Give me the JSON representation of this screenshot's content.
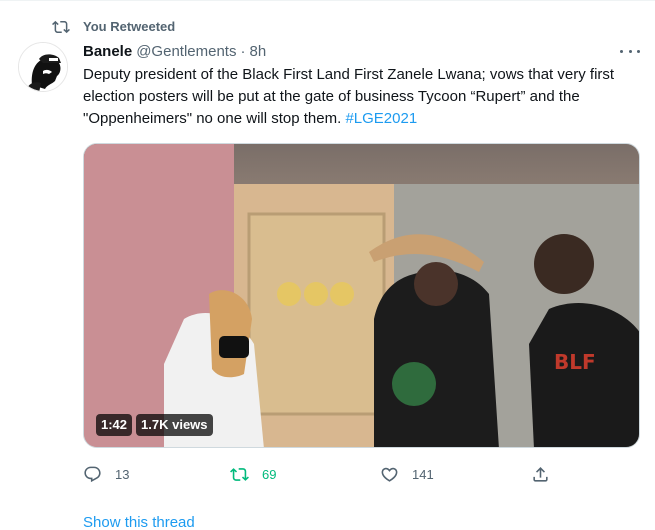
{
  "retweet_context": {
    "text": "You Retweeted",
    "icon": "retweet-icon"
  },
  "tweet": {
    "author_name": "Banele",
    "author_handle": "@Gentlements",
    "separator": "·",
    "time": "8h",
    "text_main": "Deputy president of the Black First Land First Zanele Lwana; vows that very first election posters will be put at the gate of business Tycoon “Rupert” and the \"Oppenheimers\" no one will stop them. ",
    "hashtag": "#LGE2021",
    "media": {
      "duration": "1:42",
      "views": "1.7K views"
    },
    "actions": {
      "reply_count": "13",
      "retweet_count": "69",
      "like_count": "141"
    }
  },
  "show_thread_label": "Show this thread",
  "colors": {
    "accent": "#1d9bf0",
    "retweet_active": "#00ba7c",
    "secondary_text": "#536471"
  }
}
